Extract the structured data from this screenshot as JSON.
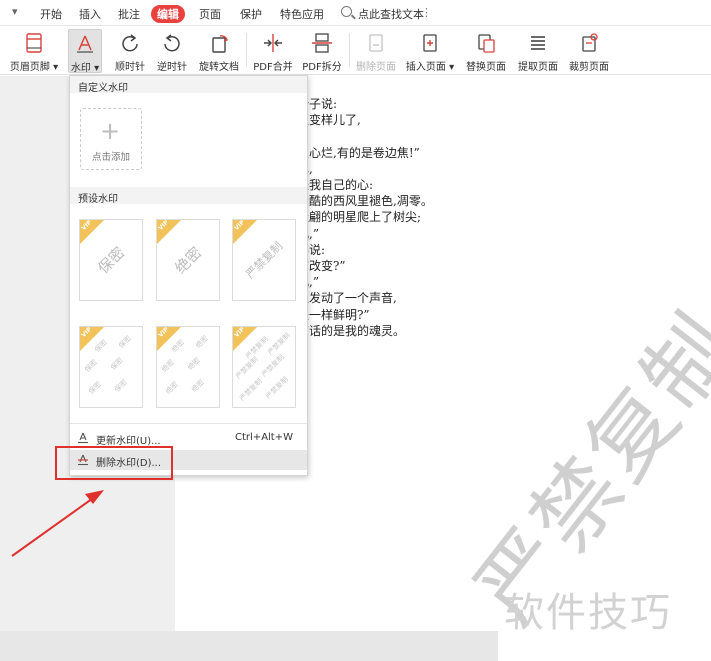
{
  "menubar": {
    "quick_arrow": "▾",
    "tabs": [
      {
        "label": "开始"
      },
      {
        "label": "插入"
      },
      {
        "label": "批注"
      },
      {
        "label": "编辑"
      },
      {
        "label": "页面"
      },
      {
        "label": "保护"
      },
      {
        "label": "特色应用"
      }
    ],
    "active_tab": "编辑",
    "search_label": "点此查找文本",
    "more_icon": "⋮"
  },
  "toolbar": {
    "items": [
      {
        "label": "页眉页脚 ▾",
        "icon": "header-footer-icon"
      },
      {
        "label": "水印 ▾",
        "icon": "watermark-icon",
        "state": "pressed"
      },
      {
        "label": "顺时针",
        "icon": "rotate-clockwise-icon"
      },
      {
        "label": "逆时针",
        "icon": "rotate-counterclockwise-icon"
      },
      {
        "label": "旋转文档",
        "icon": "rotate-document-icon"
      },
      {
        "label": "PDF合并",
        "icon": "pdf-merge-icon"
      },
      {
        "label": "PDF拆分",
        "icon": "pdf-split-icon"
      },
      {
        "label": "删除页面",
        "icon": "delete-page-icon",
        "state": "disabled"
      },
      {
        "label": "插入页面 ▾",
        "icon": "insert-page-icon"
      },
      {
        "label": "替换页面",
        "icon": "replace-page-icon"
      },
      {
        "label": "提取页面",
        "icon": "extract-page-icon"
      },
      {
        "label": "裁剪页面",
        "icon": "crop-page-icon"
      }
    ]
  },
  "watermark_menu": {
    "custom_title": "自定义水印",
    "add_label": "点击添加",
    "preset_title": "预设水印",
    "badge": "VIP",
    "presets": [
      {
        "text": "保密",
        "style": "single"
      },
      {
        "text": "绝密",
        "style": "single"
      },
      {
        "text": "严禁复制",
        "style": "single"
      },
      {
        "text": "保密",
        "style": "tiled"
      },
      {
        "text": "绝密",
        "style": "tiled"
      },
      {
        "text": "严禁复制",
        "style": "tiled"
      }
    ],
    "update_label": "更新水印(U)...",
    "update_shortcut": "Ctrl+Alt+W",
    "delete_label": "删除水印(D)..."
  },
  "document": {
    "lines": [
      "叶子说:",
      "又变样儿了,",
      "",
      "虫心烂,有的是卷边焦!”",
      "已,",
      "是我自己的心:",
      "冷酷的西风里褪色,凋零。",
      "走翩的明星爬上了树尖;",
      "儿,”",
      "弗说:",
      "有改变?”",
      "儿,”",
      "又发动了一个声音,",
      "是一样鲜明?”",
      "简话的是我的魂灵。"
    ],
    "watermark": "严禁复制"
  },
  "site_watermark": "软件技巧",
  "colors": {
    "active_tab_bg": "#e8413e",
    "annotation": "#e0302c",
    "vip_badge": "#f1c35a"
  }
}
